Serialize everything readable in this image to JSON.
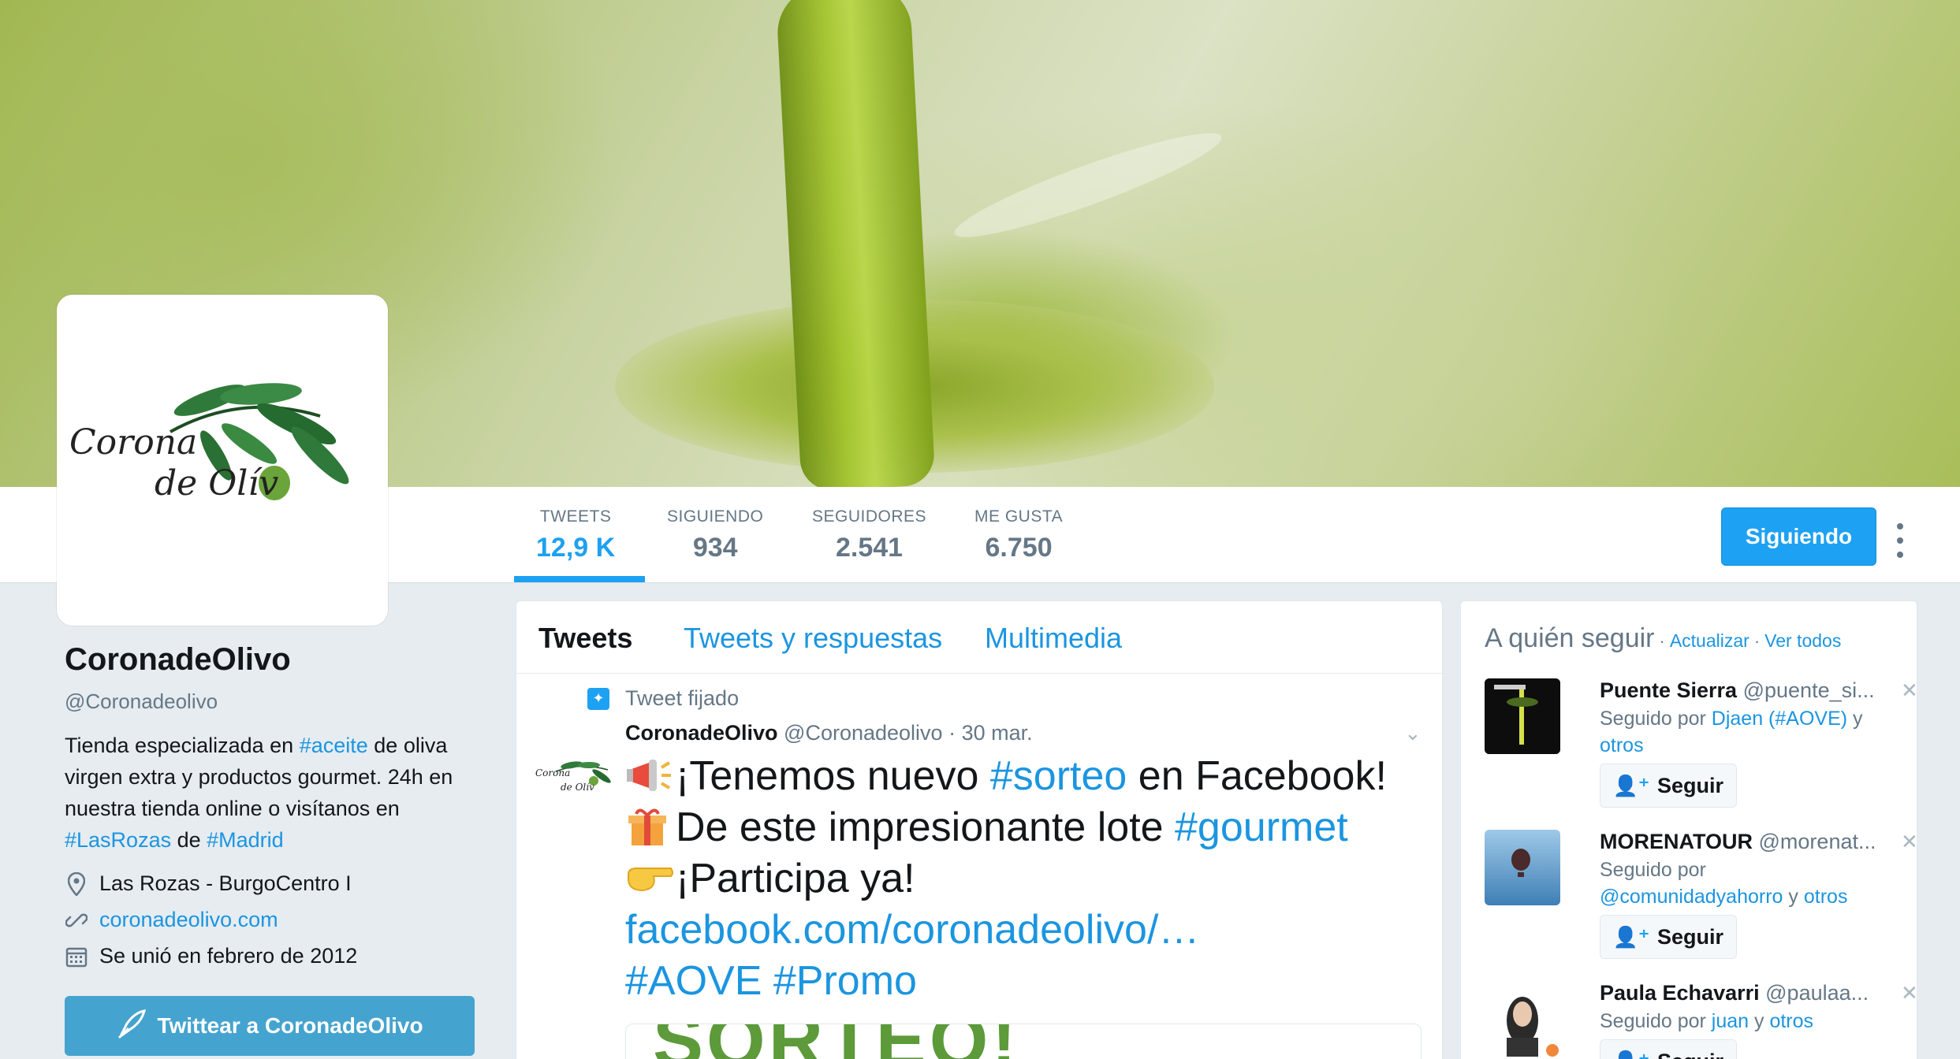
{
  "profile": {
    "name": "CoronadeOlivo",
    "handle": "@Coronadeolivo",
    "bio_parts": [
      "Tienda especializada en ",
      "#aceite",
      " de oliva virgen extra y productos gourmet. 24h en nuestra tienda online o visítanos en ",
      "#LasRozas",
      " de ",
      "#Madrid"
    ],
    "location": "Las Rozas - BurgoCentro I",
    "website": "coronadeolivo.com",
    "joined": "Se unió en febrero de 2012",
    "tweet_to_label": "Twittear a CoronadeOlivo",
    "logo_text_1": "Corona",
    "logo_text_2": "de Olív"
  },
  "stats": [
    {
      "label": "TWEETS",
      "value": "12,9 K"
    },
    {
      "label": "SIGUIENDO",
      "value": "934"
    },
    {
      "label": "SEGUIDORES",
      "value": "2.541"
    },
    {
      "label": "ME GUSTA",
      "value": "6.750"
    }
  ],
  "follow_button": "Siguiendo",
  "timeline": {
    "tabs": [
      "Tweets",
      "Tweets y respuestas",
      "Multimedia"
    ],
    "pinned_label": "Tweet fijado",
    "tweet": {
      "name": "CoronadeOlivo",
      "handle": "@Coronadeolivo",
      "date": "· 30 mar.",
      "line1_pre": "¡Tenemos nuevo ",
      "line1_tag": "#sorteo",
      "line1_post": " en Facebook!",
      "line2_pre": "De este impresionante lote ",
      "line2_tag": "#gourmet",
      "line3": "¡Participa ya!",
      "link": "facebook.com/coronadeolivo/…",
      "tag1": "#AOVE",
      "tag2": "#Promo",
      "media_text": "SORTEO!"
    }
  },
  "who_to_follow": {
    "title": "A quién seguir",
    "refresh": "Actualizar",
    "view_all": "Ver todos",
    "follow_label": "Seguir",
    "suggestions": [
      {
        "name": "Puente Sierra",
        "handle": "@puente_si...",
        "followed_by_prefix": "Seguido por ",
        "followed_by_link": "Djaen (#AOVE)",
        "followed_by_mid": " y ",
        "followed_by_end": "otros"
      },
      {
        "name": "MORENATOUR",
        "handle": "@morenat...",
        "followed_by_prefix": "Seguido por ",
        "followed_by_link": "@comunidadyahorro",
        "followed_by_mid": " y ",
        "followed_by_end": "otros"
      },
      {
        "name": "Paula Echavarri",
        "handle": "@paulaa...",
        "followed_by_prefix": "Seguido por ",
        "followed_by_link": "juan",
        "followed_by_mid": " y ",
        "followed_by_end": "otros"
      }
    ]
  },
  "colors": {
    "accent": "#1da1f2",
    "link": "#1b95e0",
    "tweet_to_button": "#45a3cf"
  }
}
